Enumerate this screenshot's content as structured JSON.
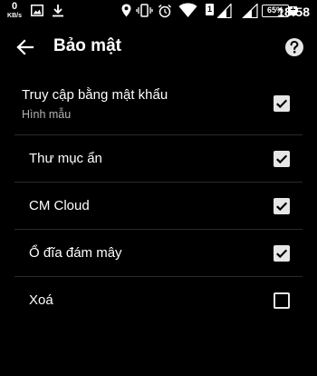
{
  "status_bar": {
    "net_speed_value": "0",
    "net_speed_unit": "KB/s",
    "sim_label": "1",
    "battery_percent": "65%",
    "battery_plus": "+",
    "time": "18:58"
  },
  "toolbar": {
    "title": "Bảo mật"
  },
  "settings": [
    {
      "title": "Truy cập bằng mật khẩu",
      "subtitle": "Hình mẫu",
      "checked": true
    },
    {
      "title": "Thư mục ẩn",
      "checked": true
    },
    {
      "title": "CM Cloud",
      "checked": true
    },
    {
      "title": "Ổ đĩa đám mây",
      "checked": true
    },
    {
      "title": "Xoá",
      "checked": false
    }
  ],
  "colors": {
    "background": "#000000",
    "text": "#ffffff",
    "subtitle": "#b3b3b3",
    "checkbox": "#e6e6e6",
    "divider": "#2a2a2a"
  }
}
